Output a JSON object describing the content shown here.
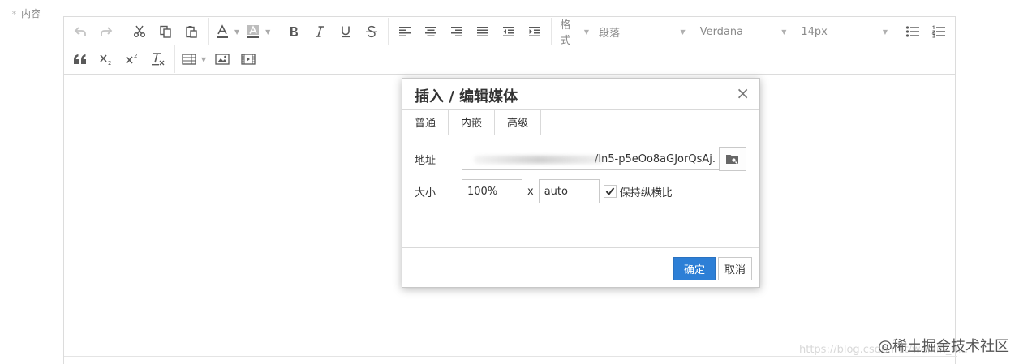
{
  "form": {
    "content_required_mark": "*",
    "content_label": "内容"
  },
  "toolbar": {
    "format_label": "格式",
    "block_select": "段落",
    "font_family_select": "Verdana",
    "font_size_select": "14px"
  },
  "icons": {
    "undo": "undo-icon",
    "redo": "redo-icon",
    "cut": "cut-icon",
    "copy": "copy-icon",
    "paste": "paste-icon",
    "text_color": "text-color-icon",
    "background_color": "background-color-icon",
    "bold": "bold-icon",
    "italic": "italic-icon",
    "underline": "underline-icon",
    "strikethrough": "strikethrough-icon",
    "align_left": "align-left-icon",
    "align_center": "align-center-icon",
    "align_right": "align-right-icon",
    "align_justify": "align-justify-icon",
    "outdent": "outdent-icon",
    "indent": "indent-icon",
    "bullet_list": "bullet-list-icon",
    "numbered_list": "numbered-list-icon",
    "blockquote": "blockquote-icon",
    "subscript": "subscript-icon",
    "superscript": "superscript-icon",
    "clear_format": "clear-format-icon",
    "table": "table-icon",
    "image": "image-icon",
    "media": "media-icon",
    "browse": "browse-folder-icon",
    "checkmark": "checkmark-icon",
    "close": "close-icon"
  },
  "dialog": {
    "title": "插入 / 编辑媒体",
    "close_glyph": "×",
    "tabs": [
      {
        "label": "普通",
        "active": true
      },
      {
        "label": "内嵌",
        "active": false
      },
      {
        "label": "高级",
        "active": false
      }
    ],
    "url_label": "地址",
    "url_value": "/ln5-p5eOo8aGJorQsAj.",
    "size_label": "大小",
    "width_value": "100%",
    "size_separator": "x",
    "height_value": "auto",
    "keep_ratio_label": "保持纵横比",
    "keep_ratio_checked": true,
    "ok_label": "确定",
    "cancel_label": "取消"
  },
  "colors": {
    "primary": "#2d7fd6",
    "border": "#dcdcdc",
    "icon": "#595959",
    "icon_disabled": "#c4c4c4"
  },
  "watermark": {
    "url_text": "https://blog.csdn.net/weixin_4...",
    "brand_text": "@稀土掘金技术社区"
  }
}
